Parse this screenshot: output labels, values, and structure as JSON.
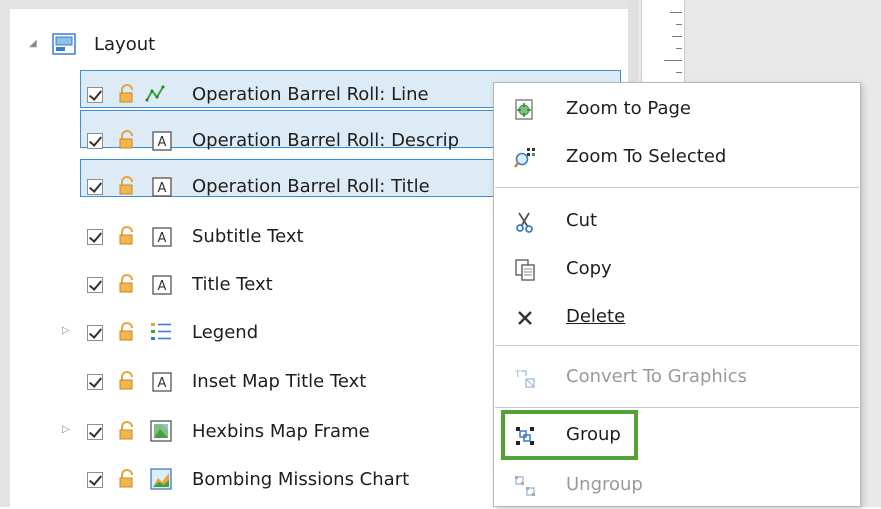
{
  "layout_root": {
    "label": "Layout",
    "expanded": true
  },
  "contents_items": [
    {
      "label": "Operation Barrel Roll: Line",
      "type": "line",
      "checked": true,
      "selected": true
    },
    {
      "label": "Operation Barrel Roll: Descrip",
      "type": "text",
      "checked": true,
      "selected": true
    },
    {
      "label": "Operation Barrel Roll: Title",
      "type": "text",
      "checked": true,
      "selected": true
    },
    {
      "label": "Subtitle Text",
      "type": "text",
      "checked": true,
      "selected": false
    },
    {
      "label": "Title Text",
      "type": "text",
      "checked": true,
      "selected": false
    },
    {
      "label": "Legend",
      "type": "legend",
      "checked": true,
      "selected": false,
      "has_children": true
    },
    {
      "label": "Inset Map Title Text",
      "type": "text",
      "checked": true,
      "selected": false
    },
    {
      "label": "Hexbins Map Frame",
      "type": "map-frame",
      "checked": true,
      "selected": false,
      "has_children": true
    },
    {
      "label": "Bombing Missions Chart",
      "type": "chart",
      "checked": true,
      "selected": false
    }
  ],
  "context_menu": {
    "zoom_to_page": "Zoom to Page",
    "zoom_to_selected": "Zoom To Selected",
    "cut": "Cut",
    "copy": "Copy",
    "delete": "Delete",
    "convert_to_graphics": "Convert To Graphics",
    "group": "Group",
    "ungroup": "Ungroup"
  },
  "colors": {
    "selection_fill": "#ddebf7",
    "selection_border": "#3c8fd4",
    "highlight_border": "#52a335",
    "lock_color": "#e8a33c"
  }
}
